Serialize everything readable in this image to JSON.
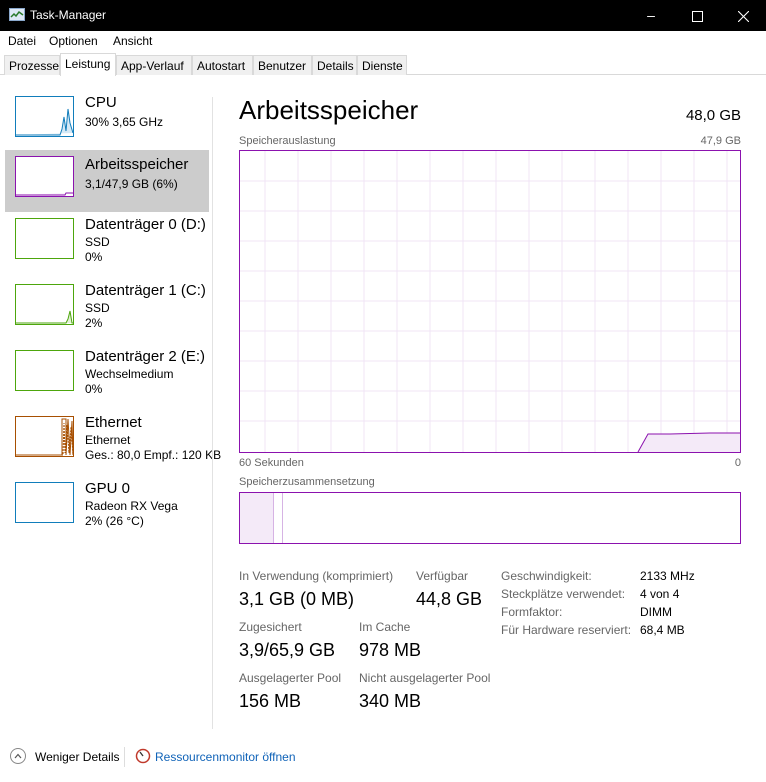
{
  "window": {
    "title": "Task-Manager"
  },
  "menu": [
    "Datei",
    "Optionen",
    "Ansicht"
  ],
  "tabs": [
    "Prozesse",
    "Leistung",
    "App-Verlauf",
    "Autostart",
    "Benutzer",
    "Details",
    "Dienste"
  ],
  "sidebar": {
    "items": [
      {
        "title": "CPU",
        "line1": "30%  3,65 GHz",
        "line2": "",
        "color": "#117dbb"
      },
      {
        "title": "Arbeitsspeicher",
        "line1": "3,1/47,9 GB (6%)",
        "line2": "",
        "color": "#8b12ae"
      },
      {
        "title": "Datenträger 0 (D:)",
        "line1": "SSD",
        "line2": "0%",
        "color": "#4da60c"
      },
      {
        "title": "Datenträger 1 (C:)",
        "line1": "SSD",
        "line2": "2%",
        "color": "#4da60c"
      },
      {
        "title": "Datenträger 2 (E:)",
        "line1": "Wechselmedium",
        "line2": "0%",
        "color": "#4da60c"
      },
      {
        "title": "Ethernet",
        "line1": "Ethernet",
        "line2": "Ges.: 80,0  Empf.: 120 KB",
        "color": "#a74f01"
      },
      {
        "title": "GPU 0",
        "line1": "Radeon RX Vega",
        "line2": "2%  (26 °C)",
        "color": "#117dbb"
      }
    ]
  },
  "main": {
    "title": "Arbeitsspeicher",
    "total": "48,0 GB",
    "chart_label": "Speicherauslastung",
    "chart_max": "47,9 GB",
    "x_left": "60 Sekunden",
    "x_right": "0",
    "comp_label": "Speicherzusammensetzung",
    "stats": {
      "in_use_label": "In Verwendung (komprimiert)",
      "in_use_value": "3,1 GB (0 MB)",
      "available_label": "Verfügbar",
      "available_value": "44,8 GB",
      "committed_label": "Zugesichert",
      "committed_value": "3,9/65,9 GB",
      "cached_label": "Im Cache",
      "cached_value": "978 MB",
      "paged_label": "Ausgelagerter Pool",
      "paged_value": "156 MB",
      "nonpaged_label": "Nicht ausgelagerter Pool",
      "nonpaged_value": "340 MB"
    },
    "details": [
      {
        "key": "Geschwindigkeit:",
        "value": "2133 MHz"
      },
      {
        "key": "Steckplätze verwendet:",
        "value": "4 von 4"
      },
      {
        "key": "Formfaktor:",
        "value": "DIMM"
      },
      {
        "key": "Für Hardware reserviert:",
        "value": "68,4 MB"
      }
    ]
  },
  "bottom": {
    "fewer_details": "Weniger Details",
    "resource_monitor": "Ressourcenmonitor öffnen"
  },
  "colors": {
    "memory": "#8b12ae",
    "cpu": "#117dbb",
    "disk": "#4da60c",
    "ethernet": "#a74f01"
  }
}
